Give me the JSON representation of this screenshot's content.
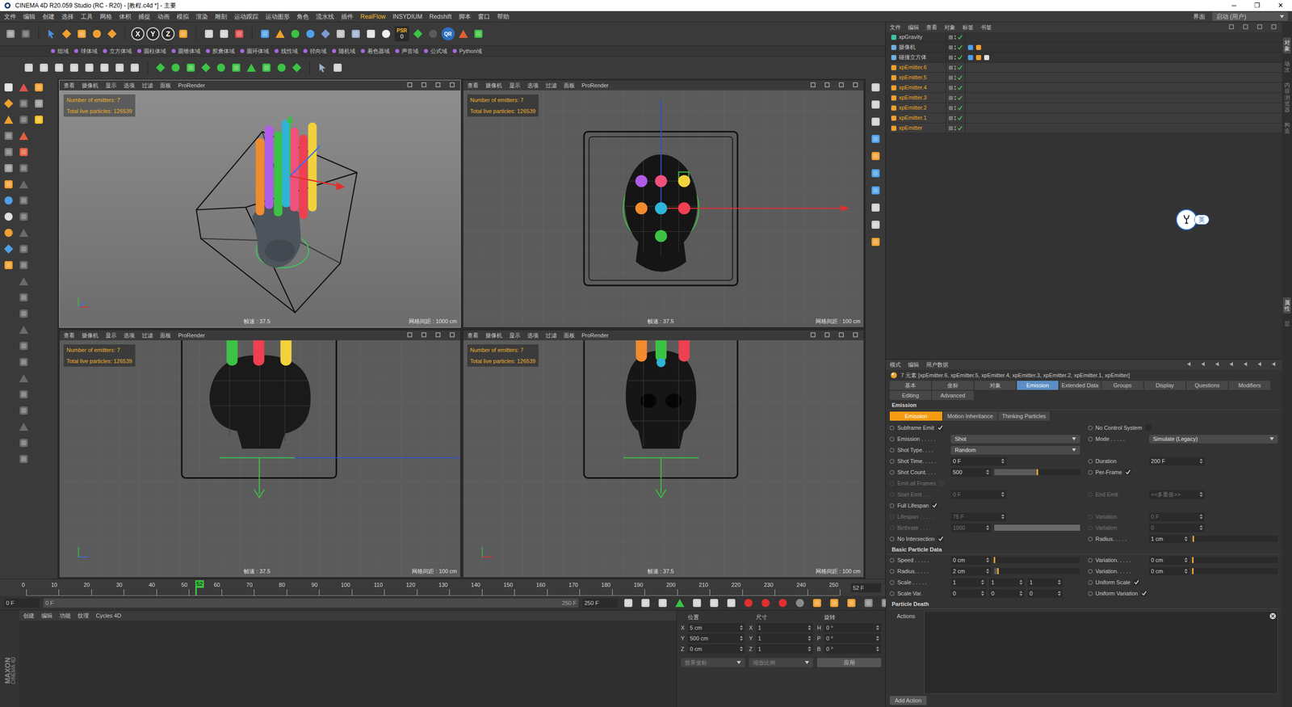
{
  "window": {
    "title": "CINEMA 4D R20.059 Studio (RC - R20) - [教程.c4d *] - 主要",
    "controls": [
      "─",
      "❐",
      "✕"
    ]
  },
  "menu": [
    {
      "label": "文件",
      "highlight": false
    },
    {
      "label": "编辑",
      "highlight": false
    },
    {
      "label": "创建",
      "highlight": false
    },
    {
      "label": "选择",
      "highlight": false
    },
    {
      "label": "工具",
      "highlight": false
    },
    {
      "label": "网格",
      "highlight": false
    },
    {
      "label": "体积",
      "highlight": false
    },
    {
      "label": "捕捉",
      "highlight": false
    },
    {
      "label": "动画",
      "highlight": false
    },
    {
      "label": "模拟",
      "highlight": false
    },
    {
      "label": "渲染",
      "highlight": false
    },
    {
      "label": "雕刻",
      "highlight": false
    },
    {
      "label": "运动跟踪",
      "highlight": false
    },
    {
      "label": "运动图形",
      "highlight": false
    },
    {
      "label": "角色",
      "highlight": false
    },
    {
      "label": "流水线",
      "highlight": false
    },
    {
      "label": "插件",
      "highlight": false
    },
    {
      "label": "RealFlow",
      "highlight": true
    },
    {
      "label": "INSYDIUM",
      "highlight": false
    },
    {
      "label": "Redshift",
      "highlight": false
    },
    {
      "label": "脚本",
      "highlight": false
    },
    {
      "label": "窗口",
      "highlight": false
    },
    {
      "label": "帮助",
      "highlight": false
    }
  ],
  "layout_switch": {
    "label": "界面",
    "value": "启动 (用户)"
  },
  "toolbar": {
    "axes": [
      "X",
      "Y",
      "Z"
    ],
    "psr": "PSR",
    "psr_value": "0",
    "qr": "QR"
  },
  "field_tabs": [
    "组域",
    "球体域",
    "立方体域",
    "圆柱体域",
    "圆锥体域",
    "胶囊体域",
    "圆环体域",
    "线性域",
    "径向域",
    "随机域",
    "着色器域",
    "声音域",
    "公式域",
    "Python域"
  ],
  "viewports": [
    {
      "kind": "perspective",
      "menu": [
        "查看",
        "摄像机",
        "显示",
        "选项",
        "过滤",
        "面板",
        "ProRender"
      ],
      "hud": [
        "Number of emitters: 7",
        "Total live particles: 126539"
      ],
      "fps": "帧速 : 37.5",
      "grid": "网格间距 : 1000 cm"
    },
    {
      "kind": "top",
      "menu": [
        "查看",
        "摄像机",
        "显示",
        "选项",
        "过滤",
        "面板",
        "ProRender"
      ],
      "hud": [
        "Number of emitters: 7",
        "Total live particles: 126539"
      ],
      "fps": "帧速 : 37.5",
      "grid": "网格间距 : 100 cm"
    },
    {
      "kind": "right",
      "menu": [
        "查看",
        "摄像机",
        "显示",
        "选项",
        "过滤",
        "面板",
        "ProRender"
      ],
      "hud": [
        "Number of emitters: 7",
        "Total live particles: 126539"
      ],
      "fps": "帧速 : 37.5",
      "grid": "网格间距 : 100 cm"
    },
    {
      "kind": "front",
      "menu": [
        "查看",
        "摄像机",
        "显示",
        "选项",
        "过滤",
        "面板",
        "ProRender"
      ],
      "hud": [
        "Number of emitters: 7",
        "Total live particles: 126539"
      ],
      "fps": "帧速 : 37.5",
      "grid": "网格间距 : 100 cm"
    }
  ],
  "scene": {
    "emitters": [
      {
        "color": "#b05ce8"
      },
      {
        "color": "#f0507a"
      },
      {
        "color": "#f2d23c"
      },
      {
        "color": "#f28a2e"
      },
      {
        "color": "#2fb4d8"
      },
      {
        "color": "#ee4050"
      },
      {
        "color": "#3cc244"
      }
    ]
  },
  "timeline": {
    "ticks": [
      "0",
      "10",
      "20",
      "30",
      "40",
      "50",
      "60",
      "70",
      "80",
      "90",
      "100",
      "110",
      "120",
      "130",
      "140",
      "150",
      "160",
      "170",
      "180",
      "190",
      "200",
      "210",
      "220",
      "230",
      "240",
      "250"
    ],
    "current": "52",
    "level": 0.208,
    "frame_field": "52 F"
  },
  "transport": {
    "start": "0 F",
    "range_start": "0 F",
    "range_end": "250 F",
    "end": "250 F",
    "range_level": 1
  },
  "materials": {
    "menu": [
      "创建",
      "编辑",
      "功能",
      "纹理",
      "Cycles 4D"
    ]
  },
  "logo": [
    "MAXON",
    "CINEMA 4D"
  ],
  "coords": {
    "headers": [
      "位置",
      "尺寸",
      "旋转"
    ],
    "rows": [
      {
        "a": "X",
        "pos": "5 cm",
        "b": "X",
        "size": "1",
        "c": "H",
        "rot": "0 °"
      },
      {
        "a": "Y",
        "pos": "500 cm",
        "b": "Y",
        "size": "1",
        "c": "P",
        "rot": "0 °"
      },
      {
        "a": "Z",
        "pos": "0 cm",
        "b": "Z",
        "size": "1",
        "c": "B",
        "rot": "0 °"
      }
    ],
    "dropdowns": [
      "世界坐标",
      "缩放比例"
    ],
    "apply": "应用"
  },
  "objects": {
    "menu": [
      "文件",
      "编辑",
      "查看",
      "对象",
      "标签",
      "书签"
    ],
    "items": [
      {
        "name": "xpGravity",
        "kind": "gravity",
        "selected": false,
        "tags": 0
      },
      {
        "name": "摄像机",
        "kind": "camera",
        "selected": false,
        "tags": 2
      },
      {
        "name": "碰撞立方体",
        "kind": "cube",
        "selected": false,
        "tags": 3
      },
      {
        "name": "xpEmitter.6",
        "kind": "emitter",
        "selected": true,
        "tags": 0
      },
      {
        "name": "xpEmitter.5",
        "kind": "emitter",
        "selected": true,
        "tags": 0
      },
      {
        "name": "xpEmitter.4",
        "kind": "emitter",
        "selected": true,
        "tags": 0
      },
      {
        "name": "xpEmitter.3",
        "kind": "emitter",
        "selected": true,
        "tags": 0
      },
      {
        "name": "xpEmitter.2",
        "kind": "emitter",
        "selected": true,
        "tags": 0
      },
      {
        "name": "xpEmitter.1",
        "kind": "emitter",
        "selected": true,
        "tags": 0
      },
      {
        "name": "xpEmitter",
        "kind": "emitter",
        "selected": true,
        "tags": 0
      }
    ]
  },
  "ime": {
    "label": "英"
  },
  "side_tabs": {
    "top": [
      {
        "label": "对象",
        "selected": true
      },
      {
        "label": "场次",
        "selected": false
      },
      {
        "label": "内容浏览器",
        "selected": false
      },
      {
        "label": "构造",
        "selected": false
      }
    ],
    "bottom": [
      {
        "label": "属性",
        "selected": true
      },
      {
        "label": "层",
        "selected": false
      }
    ]
  },
  "attributes": {
    "menu": [
      "模式",
      "编辑",
      "用户数据"
    ],
    "summary": "7 元素 [xpEmitter.6, xpEmitter.5, xpEmitter.4, xpEmitter.3, xpEmitter.2, xpEmitter.1, xpEmitter]",
    "tabs": [
      {
        "label": "基本",
        "selected": false
      },
      {
        "label": "坐标",
        "selected": false
      },
      {
        "label": "对象",
        "selected": false
      },
      {
        "label": "Emission",
        "selected": true
      },
      {
        "label": "Extended Data",
        "selected": false
      },
      {
        "label": "Groups",
        "selected": false
      },
      {
        "label": "Display",
        "selected": false
      },
      {
        "label": "Questions",
        "selected": false
      },
      {
        "label": "Modifiers",
        "selected": false
      }
    ],
    "tabs2": [
      {
        "label": "Editing",
        "selected": false
      },
      {
        "label": "Advanced",
        "selected": false
      }
    ],
    "emission": {
      "title": "Emission",
      "tabs": [
        {
          "label": "Emission",
          "selected": true
        },
        {
          "label": "Motion Inheritance",
          "selected": false
        },
        {
          "label": "Thinking Particles",
          "selected": false
        }
      ],
      "rows": [
        [
          {
            "kind": "check",
            "label": "Subframe Emit",
            "checked": true,
            "disabled": false
          },
          {
            "kind": "check",
            "label": "No Control System",
            "checked": false,
            "disabled": false
          }
        ],
        [
          {
            "kind": "dropdown",
            "label": "Emission . . . . .",
            "value": "Shot",
            "disabled": false
          },
          {
            "kind": "dropdown",
            "label": "Mode . . . . .",
            "value": "Simulate (Legacy)",
            "disabled": false
          }
        ],
        [
          {
            "kind": "dropdown",
            "label": "Shot Type. . . .",
            "value": "Random",
            "disabled": false
          }
        ],
        [
          {
            "kind": "number",
            "label": "Shot Time. . . . .",
            "value": "0 F",
            "disabled": false
          },
          {
            "kind": "number",
            "label": "Duration",
            "value": "200 F",
            "disabled": false
          }
        ],
        [
          {
            "kind": "slider",
            "label": "Shot Count. . . .",
            "value": "500",
            "level": 0.5,
            "disabled": false
          },
          {
            "kind": "check",
            "label": "Per-Frame",
            "checked": true,
            "disabled": false
          }
        ],
        [
          {
            "kind": "check",
            "label": "Emit all Frames",
            "checked": false,
            "disabled": true
          }
        ],
        [
          {
            "kind": "number",
            "label": "Start Emit . . . .",
            "value": "0 F",
            "disabled": true
          },
          {
            "kind": "number",
            "label": "End Emit",
            "value": "<<多重值>>",
            "disabled": true
          }
        ],
        [
          {
            "kind": "check",
            "label": "Full Lifespan",
            "checked": true,
            "disabled": false
          }
        ],
        [
          {
            "kind": "number",
            "label": "Lifespan . . . . .",
            "value": "75 F",
            "disabled": true
          },
          {
            "kind": "number",
            "label": "Variation",
            "value": "0 F",
            "disabled": true
          }
        ],
        [
          {
            "kind": "slider",
            "label": "Birthrate . . . .",
            "value": "1000",
            "level": 1,
            "disabled": true
          },
          {
            "kind": "number",
            "label": "Variation",
            "value": "0",
            "disabled": true
          }
        ],
        [
          {
            "kind": "check",
            "label": "No Intersection",
            "checked": true,
            "disabled": false
          },
          {
            "kind": "slider",
            "label": "Radius. . . . .",
            "value": "1 cm",
            "level": 0.01,
            "disabled": false
          }
        ]
      ]
    },
    "basic": {
      "title": "Basic Particle Data",
      "rows": [
        [
          {
            "kind": "slider",
            "label": "Speed . . . . .",
            "value": "0 cm",
            "level": 0,
            "disabled": false
          },
          {
            "kind": "slider",
            "label": "Variation. . . . .",
            "value": "0 cm",
            "level": 0,
            "disabled": false
          }
        ],
        [
          {
            "kind": "slider",
            "label": "Radius. . . . .",
            "value": "2 cm",
            "level": 0.04,
            "disabled": false
          },
          {
            "kind": "slider",
            "label": "Variation. . . . .",
            "value": "0 cm",
            "level": 0,
            "disabled": false
          }
        ],
        [
          {
            "kind": "vector",
            "label": "Scale . . . . .",
            "values": [
              "1",
              "1",
              "1"
            ],
            "disabled": false
          },
          {
            "kind": "check",
            "label": "Uniform Scale",
            "checked": true,
            "disabled": false
          }
        ],
        [
          {
            "kind": "vector",
            "label": "Scale Var.",
            "values": [
              "0",
              "0",
              "0"
            ],
            "disabled": false
          },
          {
            "kind": "check",
            "label": "Uniform Variation",
            "checked": true,
            "disabled": false
          }
        ]
      ]
    },
    "death": {
      "title": "Particle Death",
      "actions": "Actions",
      "add": "Add Action"
    }
  }
}
